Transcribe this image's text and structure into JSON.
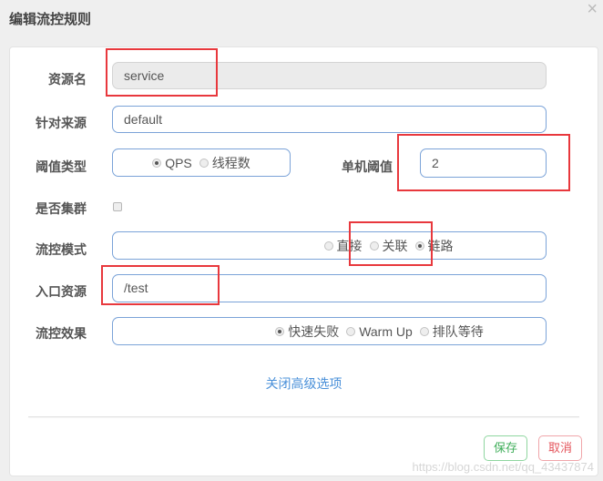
{
  "dialog": {
    "title": "编辑流控规则",
    "close_icon": "×"
  },
  "form": {
    "resource_name": {
      "label": "资源名",
      "value": "service",
      "disabled": true
    },
    "limit_app": {
      "label": "针对来源",
      "value": "default"
    },
    "grade": {
      "label": "阈值类型",
      "options": [
        {
          "label": "QPS",
          "checked": true
        },
        {
          "label": "线程数",
          "checked": false
        }
      ]
    },
    "count": {
      "label": "单机阈值",
      "value": "2"
    },
    "cluster": {
      "label": "是否集群",
      "checked": false
    },
    "strategy": {
      "label": "流控模式",
      "options": [
        {
          "label": "直接",
          "checked": false
        },
        {
          "label": "关联",
          "checked": false
        },
        {
          "label": "链路",
          "checked": true
        }
      ]
    },
    "ref_resource": {
      "label": "入口资源",
      "value": "/test"
    },
    "control_behavior": {
      "label": "流控效果",
      "options": [
        {
          "label": "快速失败",
          "checked": true
        },
        {
          "label": "Warm Up",
          "checked": false
        },
        {
          "label": "排队等待",
          "checked": false
        }
      ]
    },
    "advanced_toggle": "关闭高级选项"
  },
  "footer": {
    "save_label": "保存",
    "cancel_label": "取消"
  },
  "watermark": "https://blog.csdn.net/qq_43437874",
  "colors": {
    "accent": "#4a90d9",
    "input_border": "#7ba3d8",
    "save": "#3fae5a",
    "cancel": "#e4545b",
    "highlight": "#e8383d"
  }
}
